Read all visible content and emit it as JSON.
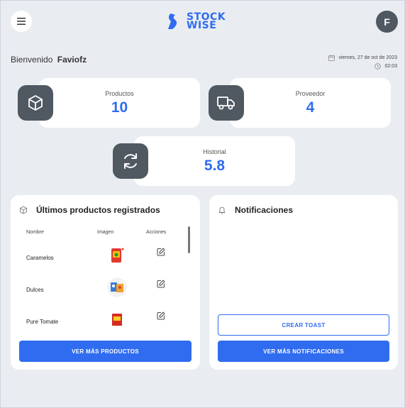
{
  "header": {
    "logo_line1": "STOCK",
    "logo_line2": "WISE",
    "avatar_initial": "F",
    "brand_color": "#2f6cf0"
  },
  "welcome": {
    "greeting": "Bienvenido",
    "username": "Faviofz"
  },
  "datetime": {
    "date": "viernes, 27 de oct de 2023",
    "time": "02:03"
  },
  "stats": [
    {
      "label": "Productos",
      "value": "10",
      "icon": "box-icon"
    },
    {
      "label": "Proveedor",
      "value": "4",
      "icon": "truck-icon"
    },
    {
      "label": "Historial",
      "value": "5.8",
      "icon": "refresh-icon"
    }
  ],
  "products_panel": {
    "title": "Últimos productos registrados",
    "columns": [
      "Nombre",
      "Imagen",
      "Acciones"
    ],
    "rows": [
      {
        "name": "Caramelos"
      },
      {
        "name": "Dulces"
      },
      {
        "name": "Pure Tomate"
      }
    ],
    "button": "VER MÁS PRODUCTOS"
  },
  "notifications_panel": {
    "title": "Notificaciones",
    "toast_button": "CREAR TOAST",
    "button": "VER MÁS NOTIFICACIONES"
  }
}
